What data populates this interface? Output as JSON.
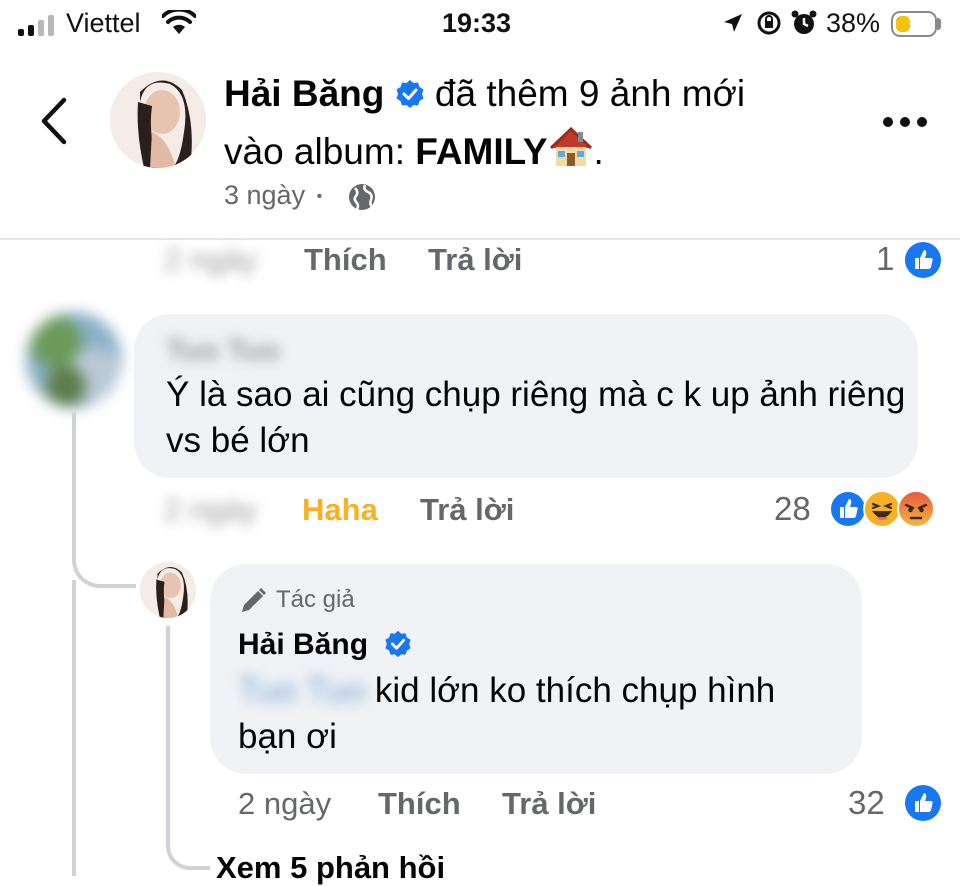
{
  "status_bar": {
    "carrier": "Viettel",
    "time": "19:33",
    "battery": "38%",
    "battery_level": 0.38
  },
  "post_header": {
    "author": "Hải Băng",
    "action_line1": "đã thêm 9 ảnh mới",
    "action_line2_prefix": "vào album: ",
    "album": "FAMILY",
    "album_suffix": ".",
    "time": "3 ngày",
    "separator": "•",
    "privacy_icon": "globe-icon"
  },
  "top_comment_actions": {
    "time": "2 ngày",
    "like": "Thích",
    "reply": "Trả lời",
    "like_count": "1"
  },
  "comment": {
    "commenter": "Tuo Tuo",
    "text": "Ý là sao ai cũng chụp riêng mà c k up ảnh riêng vs bé lớn",
    "time": "2 ngày",
    "reaction_label": "Haha",
    "reply": "Trả lời",
    "reaction_count": "28",
    "reaction_icons": [
      "like-icon",
      "haha-icon",
      "angry-icon"
    ]
  },
  "reply": {
    "badge": "Tác giả",
    "author": "Hải Băng",
    "mention": "Tuo Tuo",
    "text": "kid lớn ko thích chụp hình bạn ơi",
    "time": "2 ngày",
    "like": "Thích",
    "reply": "Trả lời",
    "like_count": "32"
  },
  "view_more": "Xem 5 phản hồi",
  "colors": {
    "verified_blue": "#1877f2",
    "haha_label": "#f7b125",
    "secondary_text": "#65676b",
    "bubble_bg": "#f0f2f5"
  }
}
